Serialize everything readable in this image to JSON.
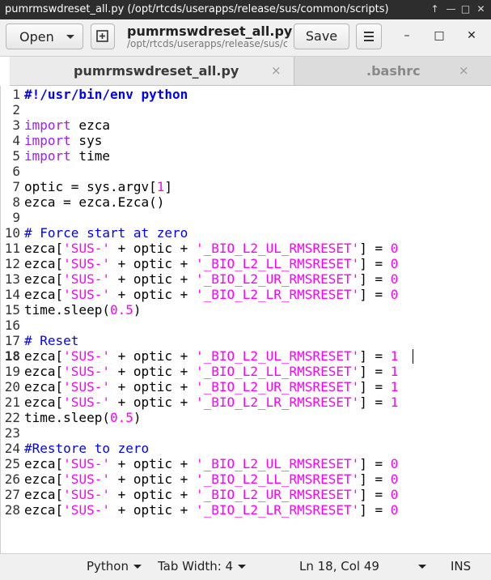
{
  "window": {
    "title": "pumrmswdreset_all.py (/opt/rtcds/userapps/release/sus/common/scripts)",
    "controls": [
      "↑",
      "—",
      "□",
      "✕"
    ]
  },
  "header": {
    "open_label": "Open",
    "doc_title": "pumrmswdreset_all.py",
    "doc_path": "/opt/rtcds/userapps/release/sus/common/scripts",
    "save_label": "Save",
    "minimize_glyph": "–",
    "maximize_glyph": "□",
    "close_glyph": "✕"
  },
  "tabs": [
    {
      "label": "pumrmswdreset_all.py",
      "close": "×",
      "active": true
    },
    {
      "label": ".bashrc",
      "close": "×",
      "active": false
    }
  ],
  "editor": {
    "current_line": 18,
    "lines": [
      [
        [
          "shebang",
          "#!/usr/bin/env python"
        ]
      ],
      [],
      [
        [
          "kw",
          "import"
        ],
        [
          "",
          " ezca"
        ]
      ],
      [
        [
          "kw",
          "import"
        ],
        [
          "",
          " sys"
        ]
      ],
      [
        [
          "kw",
          "import"
        ],
        [
          "",
          " time"
        ]
      ],
      [],
      [
        [
          "",
          "optic = sys.argv["
        ],
        [
          "num",
          "1"
        ],
        [
          "",
          "]"
        ]
      ],
      [
        [
          "",
          "ezca = ezca.Ezca()"
        ]
      ],
      [],
      [
        [
          "cm",
          "# Force start at zero"
        ]
      ],
      [
        [
          "",
          "ezca["
        ],
        [
          "str",
          "'SUS-'"
        ],
        [
          "",
          " + optic + "
        ],
        [
          "str",
          "'_BIO_L2_UL_RMSRESET'"
        ],
        [
          "",
          "] = "
        ],
        [
          "num",
          "0"
        ]
      ],
      [
        [
          "",
          "ezca["
        ],
        [
          "str",
          "'SUS-'"
        ],
        [
          "",
          " + optic + "
        ],
        [
          "str",
          "'_BIO_L2_LL_RMSRESET'"
        ],
        [
          "",
          "] = "
        ],
        [
          "num",
          "0"
        ]
      ],
      [
        [
          "",
          "ezca["
        ],
        [
          "str",
          "'SUS-'"
        ],
        [
          "",
          " + optic + "
        ],
        [
          "str",
          "'_BIO_L2_UR_RMSRESET'"
        ],
        [
          "",
          "] = "
        ],
        [
          "num",
          "0"
        ]
      ],
      [
        [
          "",
          "ezca["
        ],
        [
          "str",
          "'SUS-'"
        ],
        [
          "",
          " + optic + "
        ],
        [
          "str",
          "'_BIO_L2_LR_RMSRESET'"
        ],
        [
          "",
          "] = "
        ],
        [
          "num",
          "0"
        ]
      ],
      [
        [
          "",
          "time.sleep("
        ],
        [
          "num",
          "0.5"
        ],
        [
          "",
          ")"
        ]
      ],
      [],
      [
        [
          "cm",
          "# Reset"
        ]
      ],
      [
        [
          "",
          "ezca["
        ],
        [
          "str",
          "'SUS-'"
        ],
        [
          "",
          " + optic + "
        ],
        [
          "str",
          "'_BIO_L2_UL_RMSRESET'"
        ],
        [
          "",
          "] = "
        ],
        [
          "num",
          "1"
        ]
      ],
      [
        [
          "",
          "ezca["
        ],
        [
          "str",
          "'SUS-'"
        ],
        [
          "",
          " + optic + "
        ],
        [
          "str",
          "'_BIO_L2_LL_RMSRESET'"
        ],
        [
          "",
          "] = "
        ],
        [
          "num",
          "1"
        ]
      ],
      [
        [
          "",
          "ezca["
        ],
        [
          "str",
          "'SUS-'"
        ],
        [
          "",
          " + optic + "
        ],
        [
          "str",
          "'_BIO_L2_UR_RMSRESET'"
        ],
        [
          "",
          "] = "
        ],
        [
          "num",
          "1"
        ]
      ],
      [
        [
          "",
          "ezca["
        ],
        [
          "str",
          "'SUS-'"
        ],
        [
          "",
          " + optic + "
        ],
        [
          "str",
          "'_BIO_L2_LR_RMSRESET'"
        ],
        [
          "",
          "] = "
        ],
        [
          "num",
          "1"
        ]
      ],
      [
        [
          "",
          "time.sleep("
        ],
        [
          "num",
          "0.5"
        ],
        [
          "",
          ")"
        ]
      ],
      [],
      [
        [
          "cm",
          "#Restore to zero"
        ]
      ],
      [
        [
          "",
          "ezca["
        ],
        [
          "str",
          "'SUS-'"
        ],
        [
          "",
          " + optic + "
        ],
        [
          "str",
          "'_BIO_L2_UL_RMSRESET'"
        ],
        [
          "",
          "] = "
        ],
        [
          "num",
          "0"
        ]
      ],
      [
        [
          "",
          "ezca["
        ],
        [
          "str",
          "'SUS-'"
        ],
        [
          "",
          " + optic + "
        ],
        [
          "str",
          "'_BIO_L2_LL_RMSRESET'"
        ],
        [
          "",
          "] = "
        ],
        [
          "num",
          "0"
        ]
      ],
      [
        [
          "",
          "ezca["
        ],
        [
          "str",
          "'SUS-'"
        ],
        [
          "",
          " + optic + "
        ],
        [
          "str",
          "'_BIO_L2_UR_RMSRESET'"
        ],
        [
          "",
          "] = "
        ],
        [
          "num",
          "0"
        ]
      ],
      [
        [
          "",
          "ezca["
        ],
        [
          "str",
          "'SUS-'"
        ],
        [
          "",
          " + optic + "
        ],
        [
          "str",
          "'_BIO_L2_LR_RMSRESET'"
        ],
        [
          "",
          "] = "
        ],
        [
          "num",
          "0"
        ]
      ]
    ]
  },
  "statusbar": {
    "language": "Python",
    "tab_width": "Tab Width: 4",
    "position": "Ln 18, Col 49",
    "mode": "INS"
  },
  "colors": {
    "keyword": "#a020f0",
    "comment": "#0000ff",
    "string": "#ff00ff",
    "number": "#ff00ff"
  }
}
